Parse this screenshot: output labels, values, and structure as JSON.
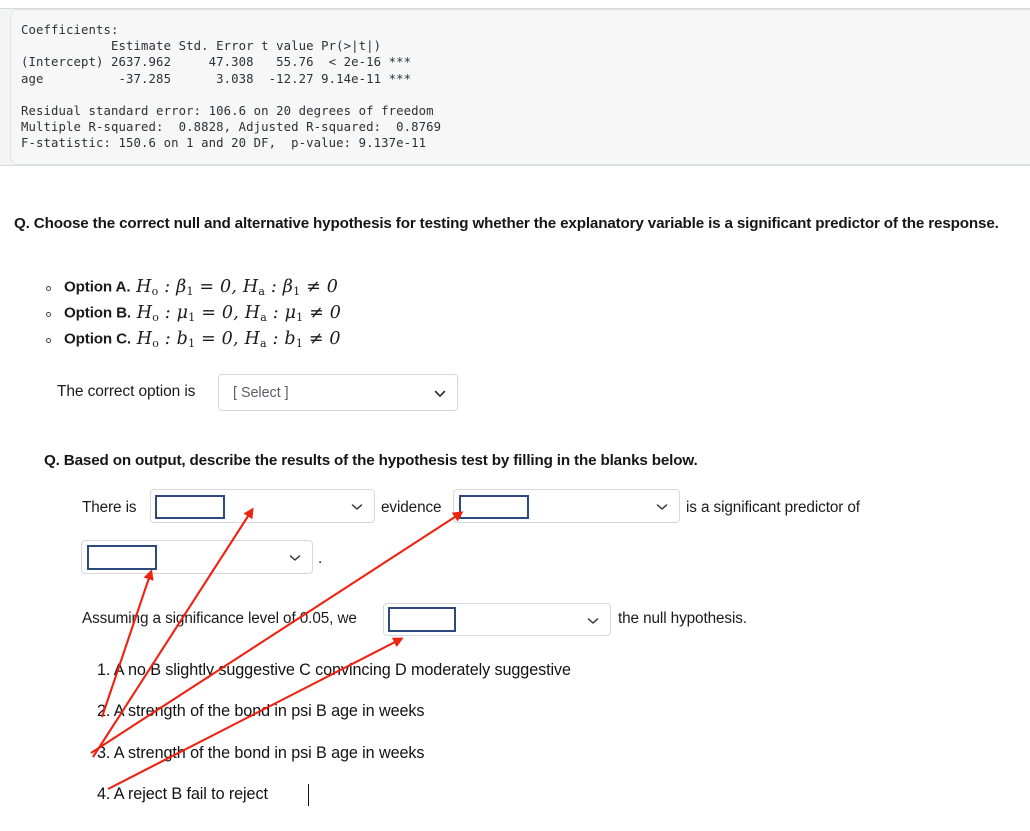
{
  "code_output": {
    "name": "r-regression-summary",
    "text": "Coefficients:\n            Estimate Std. Error t value Pr(>|t|)    \n(Intercept) 2637.962     47.308   55.76  < 2e-16 ***\nage          -37.285      3.038  -12.27 9.14e-11 ***\n\nResidual standard error: 106.6 on 20 degrees of freedom\nMultiple R-squared:  0.8828, Adjusted R-squared:  0.8769 \nF-statistic: 150.6 on 1 and 20 DF,  p-value: 9.137e-11"
  },
  "question1": {
    "prompt": "Q. Choose the correct null and alternative hypothesis for testing whether the explanatory variable is a significant predictor of the response.",
    "options": [
      {
        "label": "Option A.",
        "formula_plain": "Ho : β1 = 0, Ha : β1 ≠ 0",
        "symbol": "β"
      },
      {
        "label": "Option B.",
        "formula_plain": "Ho : μ1 = 0, Ha : μ1 ≠ 0",
        "symbol": "μ"
      },
      {
        "label": "Option C.",
        "formula_plain": "Ho : b1 = 0, Ha : b1 ≠ 0",
        "symbol": "b"
      }
    ],
    "answer_prefix": "The correct option is",
    "select_value": "[ Select ]"
  },
  "question2": {
    "prompt": "Q. Based on output, describe the results of the hypothesis test by filling in the blanks below.",
    "fragments": {
      "there_is": "There is",
      "evidence": "evidence",
      "is_significant_predictor_of": "is a significant predictor of",
      "period": ".",
      "assuming": "Assuming a significance level of 0.05, we",
      "null_hypothesis": "the null hypothesis."
    },
    "selects": [
      {
        "name": "evidence-strength-select",
        "value": ""
      },
      {
        "name": "predictor-variable-select",
        "value": ""
      },
      {
        "name": "response-variable-select",
        "value": ""
      },
      {
        "name": "decision-select",
        "value": ""
      }
    ]
  },
  "answer_lines": [
    "1. A no B slightly suggestive C convincing D moderately suggestive",
    "2. A strength of the bond in psi B age in weeks",
    "3. A strength of the bond in psi B age in weeks",
    "4. A reject B fail to reject"
  ],
  "colors": {
    "annotation_red": "#ee2211",
    "highlight_blue": "#2c4a7c",
    "code_background": "#f4f4f5",
    "select_border": "#d8d8d8",
    "placeholder_text": "#5c5c66"
  }
}
